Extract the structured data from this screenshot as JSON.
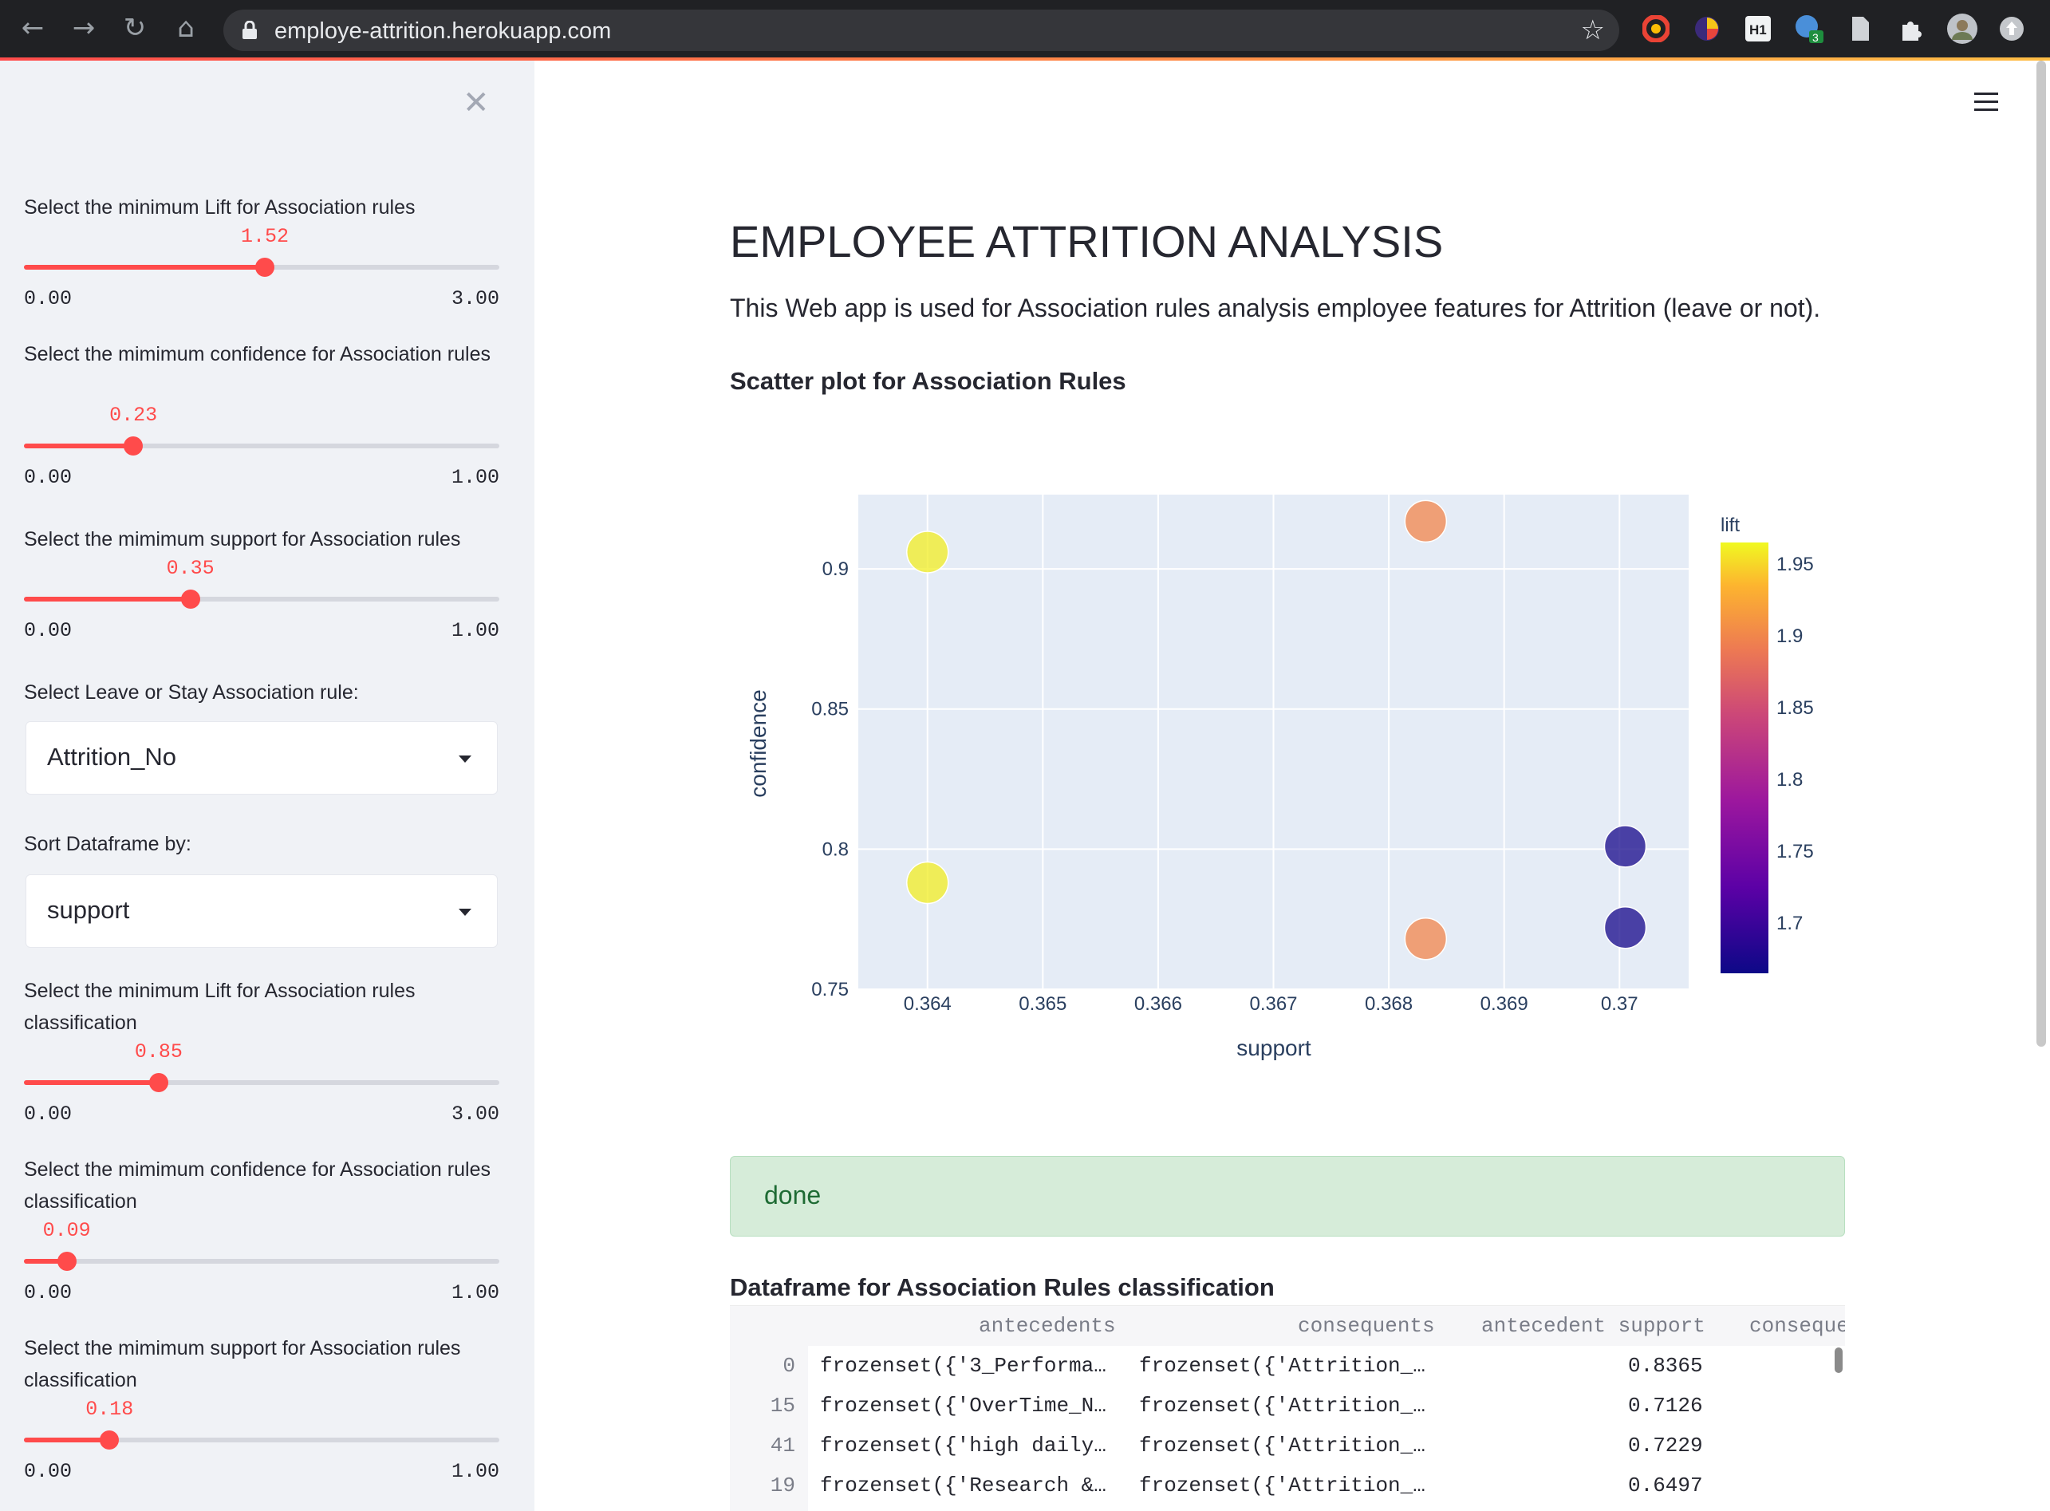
{
  "browser": {
    "url": "employe-attrition.herokuapp.com",
    "extension_badge": "3"
  },
  "sidebar": {
    "sliders": [
      {
        "label": "Select the minimum Lift for Association rules",
        "value": "1.52",
        "value_num": 1.52,
        "min": "0.00",
        "max": "3.00",
        "max_num": 3.0
      },
      {
        "label": "Select the mimimum confidence for Association rules",
        "value": "0.23",
        "value_num": 0.23,
        "min": "0.00",
        "max": "1.00",
        "max_num": 1.0
      },
      {
        "label": "Select the mimimum support for Association rules",
        "value": "0.35",
        "value_num": 0.35,
        "min": "0.00",
        "max": "1.00",
        "max_num": 1.0
      },
      {
        "label": "Select the minimum Lift for Association rules classification",
        "value": "0.85",
        "value_num": 0.85,
        "min": "0.00",
        "max": "3.00",
        "max_num": 3.0
      },
      {
        "label": "Select the mimimum confidence for Association rules classification",
        "value": "0.09",
        "value_num": 0.09,
        "min": "0.00",
        "max": "1.00",
        "max_num": 1.0
      },
      {
        "label": "Select the mimimum support for Association rules classification",
        "value": "0.18",
        "value_num": 0.18,
        "min": "0.00",
        "max": "1.00",
        "max_num": 1.0
      }
    ],
    "selects": [
      {
        "label": "Select Leave or Stay Association rule:",
        "value": "Attrition_No"
      },
      {
        "label": "Sort Dataframe by:",
        "value": "support"
      }
    ]
  },
  "main": {
    "title": "EMPLOYEE ATTRITION ANALYSIS",
    "description": "This Web app is used for Association rules analysis employee features for Attrition (leave or not).",
    "scatter_heading": "Scatter plot for Association Rules",
    "status": "done",
    "dataframe_heading": "Dataframe for Association Rules classification"
  },
  "chart_data": {
    "type": "scatter",
    "xlabel": "support",
    "ylabel": "confidence",
    "xlim": [
      0.3634,
      0.3706
    ],
    "ylim": [
      0.75,
      0.9265
    ],
    "xticks": [
      0.364,
      0.365,
      0.366,
      0.367,
      0.368,
      0.369,
      0.37
    ],
    "xtick_labels": [
      "0.364",
      "0.365",
      "0.366",
      "0.367",
      "0.368",
      "0.369",
      "0.37"
    ],
    "yticks": [
      0.75,
      0.8,
      0.85,
      0.9
    ],
    "ytick_labels": [
      "0.75",
      "0.8",
      "0.85",
      "0.9"
    ],
    "grid": true,
    "colorbar": {
      "title": "lift",
      "range": [
        1.665,
        1.965
      ],
      "ticks": [
        1.7,
        1.75,
        1.8,
        1.85,
        1.9,
        1.95
      ],
      "tick_labels": [
        "1.7",
        "1.75",
        "1.8",
        "1.85",
        "1.9",
        "1.95"
      ]
    },
    "points": [
      {
        "x": 0.364,
        "y": 0.906,
        "lift": 1.96
      },
      {
        "x": 0.364,
        "y": 0.788,
        "lift": 1.96
      },
      {
        "x": 0.36832,
        "y": 0.917,
        "lift": 1.9
      },
      {
        "x": 0.36832,
        "y": 0.768,
        "lift": 1.9
      },
      {
        "x": 0.37005,
        "y": 0.801,
        "lift": 1.67
      },
      {
        "x": 0.37005,
        "y": 0.772,
        "lift": 1.67
      }
    ]
  },
  "dataframe": {
    "columns": [
      "antecedents",
      "consequents",
      "antecedent support",
      "conseque"
    ],
    "rows": [
      {
        "index": "0",
        "antecedents": "frozenset({'3_Performa…",
        "consequents": "frozenset({'Attrition_…",
        "antecedent_support": "0.8365"
      },
      {
        "index": "15",
        "antecedents": "frozenset({'OverTime_N…",
        "consequents": "frozenset({'Attrition_…",
        "antecedent_support": "0.7126"
      },
      {
        "index": "41",
        "antecedents": "frozenset({'high daily…",
        "consequents": "frozenset({'Attrition_…",
        "antecedent_support": "0.7229"
      },
      {
        "index": "19",
        "antecedents": "frozenset({'Research &…",
        "consequents": "frozenset({'Attrition_…",
        "antecedent_support": "0.6497"
      }
    ]
  },
  "colors": {
    "accent": "#ff4b4b",
    "sidebar_bg": "#f0f2f6",
    "plot_bg": "#e5ecf6",
    "success_bg": "#d6ecd9"
  },
  "icons": [
    "back-icon",
    "forward-icon",
    "reload-icon",
    "home-icon",
    "lock-icon",
    "star-icon",
    "close-icon",
    "hamburger-menu-icon",
    "chevron-down-icon"
  ]
}
